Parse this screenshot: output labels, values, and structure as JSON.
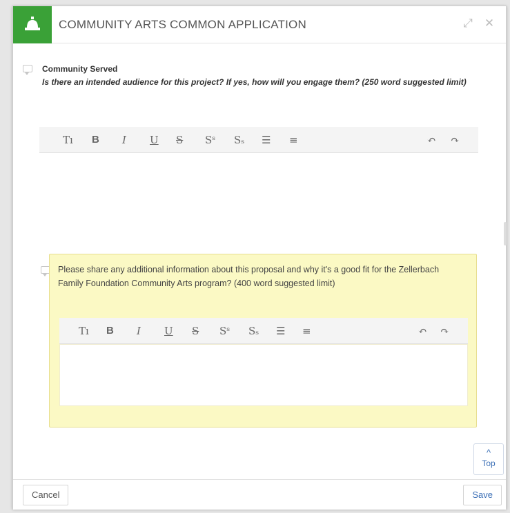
{
  "window": {
    "title": "COMMUNITY ARTS COMMON APPLICATION",
    "brand_color": "#3aa137"
  },
  "question1": {
    "label": "Community Served",
    "text": "Is there an intended audience for this project? If yes, how will you engage them? (250 word suggested limit)"
  },
  "question2": {
    "text": "Please share any additional information about this proposal and why it's a good fit for the Zellerbach Family Foundation Community Arts program? (400 word suggested limit)"
  },
  "toolbar": {
    "text_style": "Tı",
    "bold": "B",
    "italic": "I",
    "underline": "U",
    "strike": "S",
    "superscript": "Sˢ",
    "subscript": "Sₛ",
    "list": "☰",
    "align": "≡",
    "undo": "↶",
    "redo": "↷"
  },
  "top_button": {
    "label": "Top",
    "arrow": "^"
  },
  "footer": {
    "cancel_label": "Cancel",
    "save_label": "Save"
  }
}
